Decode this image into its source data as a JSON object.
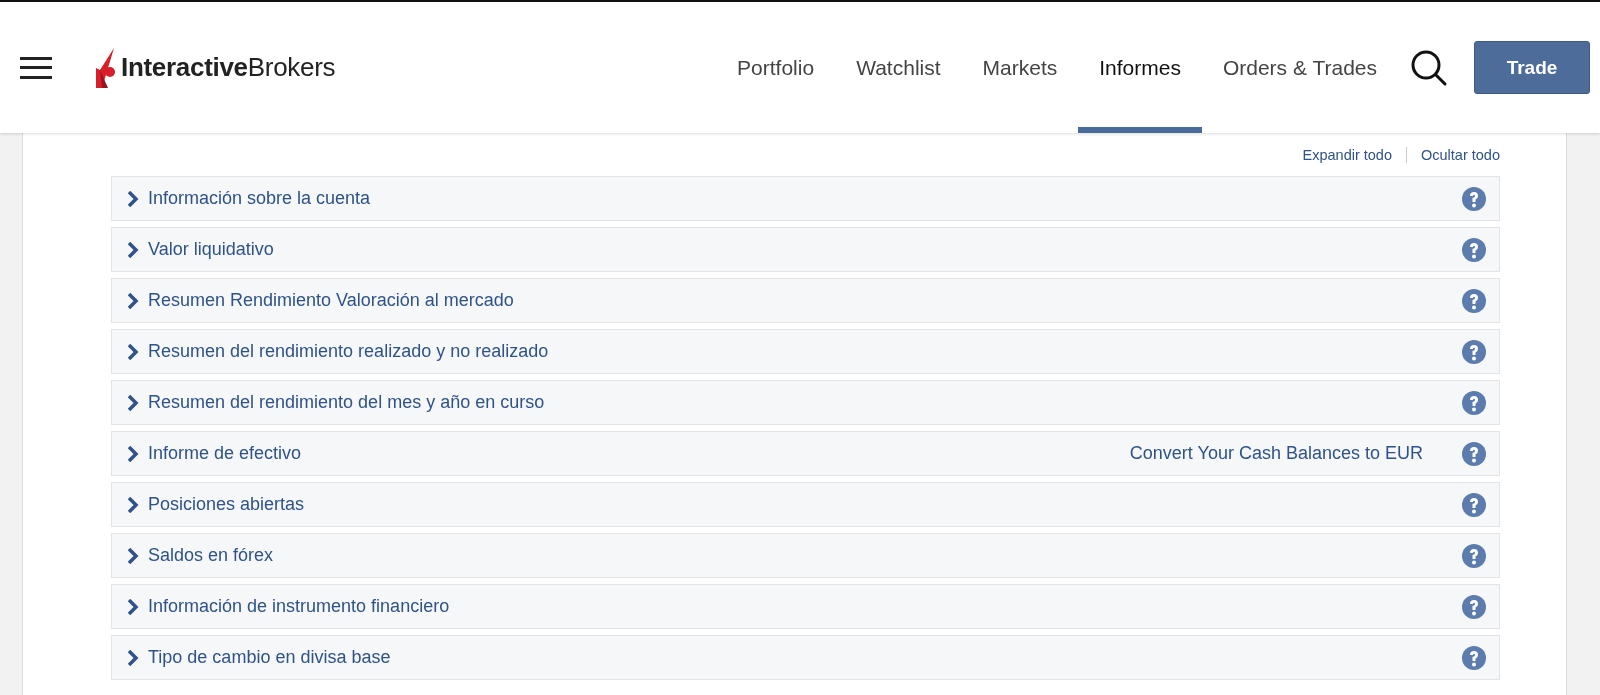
{
  "header": {
    "logo": "**Interactive**Brokers",
    "nav": [
      {
        "label": "Portfolio",
        "selected": false
      },
      {
        "label": "Watchlist",
        "selected": false
      },
      {
        "label": "Markets",
        "selected": false
      },
      {
        "label": "Informes",
        "selected": true
      },
      {
        "label": "Orders & Trades",
        "selected": false
      }
    ],
    "trade_button": "Trade"
  },
  "toolbar": {
    "expand_all": "Expandir todo",
    "collapse_all": "Ocultar todo"
  },
  "sections": [
    {
      "title": "Información sobre la cuenta",
      "expanded": false
    },
    {
      "title": "Valor liquidativo",
      "expanded": false
    },
    {
      "title": "Resumen Rendimiento Valoración al mercado",
      "expanded": false
    },
    {
      "title": "Resumen del rendimiento realizado y no realizado",
      "expanded": false
    },
    {
      "title": "Resumen del rendimiento del mes y año en curso",
      "expanded": false
    },
    {
      "title": "Informe de efectivo",
      "expanded": false,
      "link": "Convert Your Cash Balances to EUR"
    },
    {
      "title": "Posiciones abiertas",
      "expanded": false
    },
    {
      "title": "Saldos en fórex",
      "expanded": false
    },
    {
      "title": "Información de instrumento financiero",
      "expanded": false
    },
    {
      "title": "Tipo de cambio en divisa base",
      "expanded": false
    }
  ]
}
